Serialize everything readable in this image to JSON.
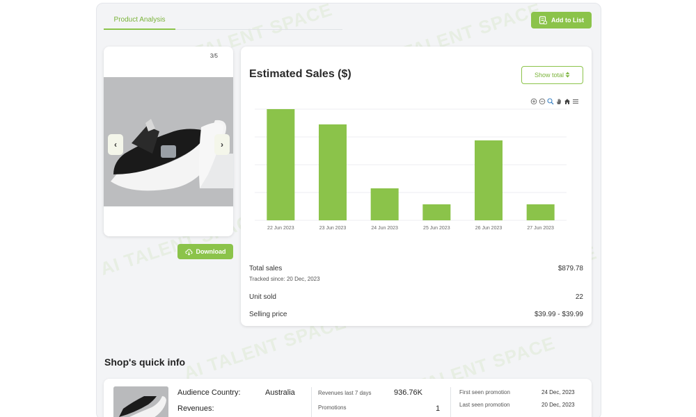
{
  "header": {
    "tab_label": "Product Analysis",
    "add_to_list_label": "Add to List"
  },
  "product": {
    "image_counter": "3/5",
    "prev_label": "‹",
    "next_label": "›",
    "download_label": "Download"
  },
  "sales": {
    "title": "Estimated Sales ($)",
    "show_total_label": "Show total",
    "toolbar_icons": [
      "zoom-in-icon",
      "zoom-out-icon",
      "magnify-icon",
      "pan-hand-icon",
      "home-icon",
      "menu-icon"
    ],
    "total_sales_label": "Total sales",
    "tracked_since": "Tracked since: 20 Dec, 2023",
    "total_sales_value": "$879.78",
    "unit_sold_label": "Unit sold",
    "unit_sold_value": "22",
    "selling_price_label": "Selling price",
    "selling_price_value": "$39.99 - $39.99"
  },
  "chart_data": {
    "type": "bar",
    "categories": [
      "22 Jun 2023",
      "23 Jun 2023",
      "24 Jun 2023",
      "25 Jun 2023",
      "26 Jun 2023",
      "27 Jun 2023"
    ],
    "values": [
      8,
      6.9,
      2.3,
      1.15,
      5.75,
      1.15
    ],
    "ylim": [
      0,
      8
    ],
    "grid": true,
    "color": "#8bc34a"
  },
  "shop": {
    "title": "Shop's quick info",
    "audience_country_label": "Audience Country:",
    "audience_country_value": "Australia",
    "revenues_label": "Revenues:",
    "revenues_7d_label": "Revenues last 7 days",
    "revenues_7d_value": "936.76K",
    "promotions_label": "Promotions",
    "promotions_value": "1",
    "first_seen_label": "First seen promotion",
    "first_seen_value": "24 Dec, 2023",
    "last_seen_label": "Last seen promotion",
    "last_seen_value": "20 Dec, 2023"
  },
  "watermark": "AI TALENT SPACE",
  "colors": {
    "accent": "#8bc34a",
    "background": "#f3f4f6"
  }
}
